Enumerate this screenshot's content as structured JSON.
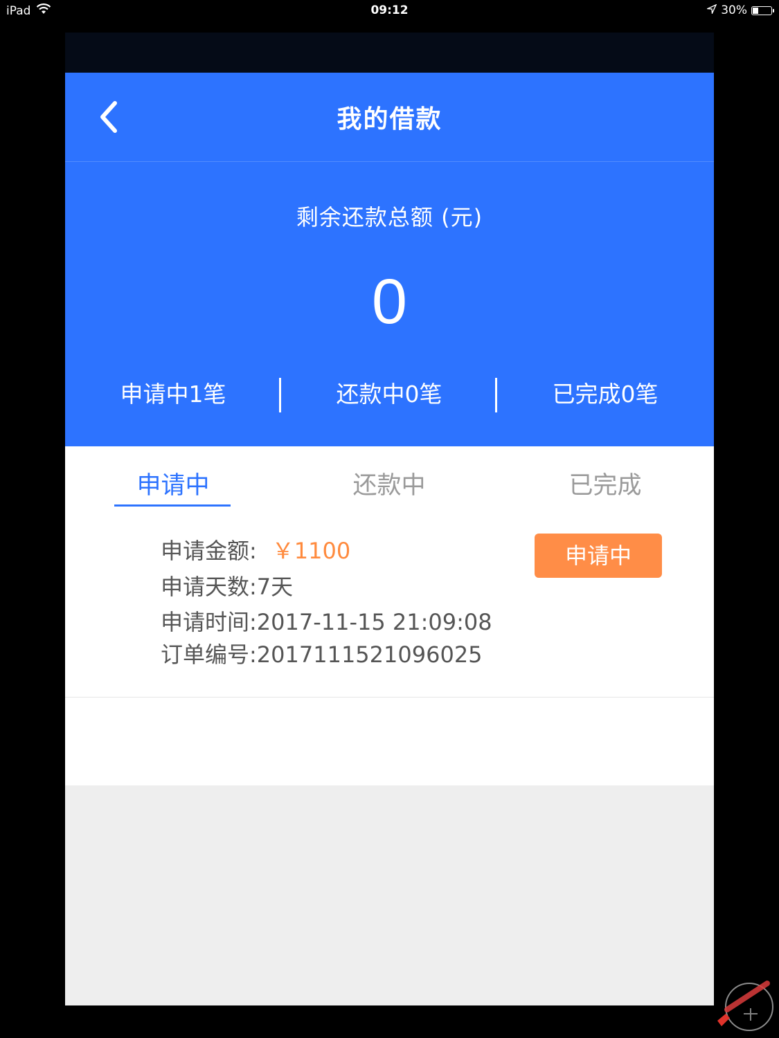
{
  "status_bar": {
    "device": "iPad",
    "time": "09:12",
    "battery": "30%",
    "battery_level": 0.3
  },
  "navbar": {
    "title": "我的借款"
  },
  "summary": {
    "label": "剩余还款总额 (元)",
    "amount": "0",
    "stats": [
      {
        "label": "申请中1笔"
      },
      {
        "label": "还款中0笔"
      },
      {
        "label": "已完成0笔"
      }
    ]
  },
  "tabs": [
    {
      "label": "申请中",
      "active": true
    },
    {
      "label": "还款中",
      "active": false
    },
    {
      "label": "已完成",
      "active": false
    }
  ],
  "order": {
    "amount_label": "申请金额:",
    "amount_value": "￥1100",
    "days": "申请天数:7天",
    "time": "申请时间:2017-11-15 21:09:08",
    "order_no": "订单编号:2017111521096025",
    "status_button": "申请中"
  },
  "colors": {
    "primary": "#2d73ff",
    "accent": "#ff8d47",
    "amount": "#ff8a3d"
  }
}
